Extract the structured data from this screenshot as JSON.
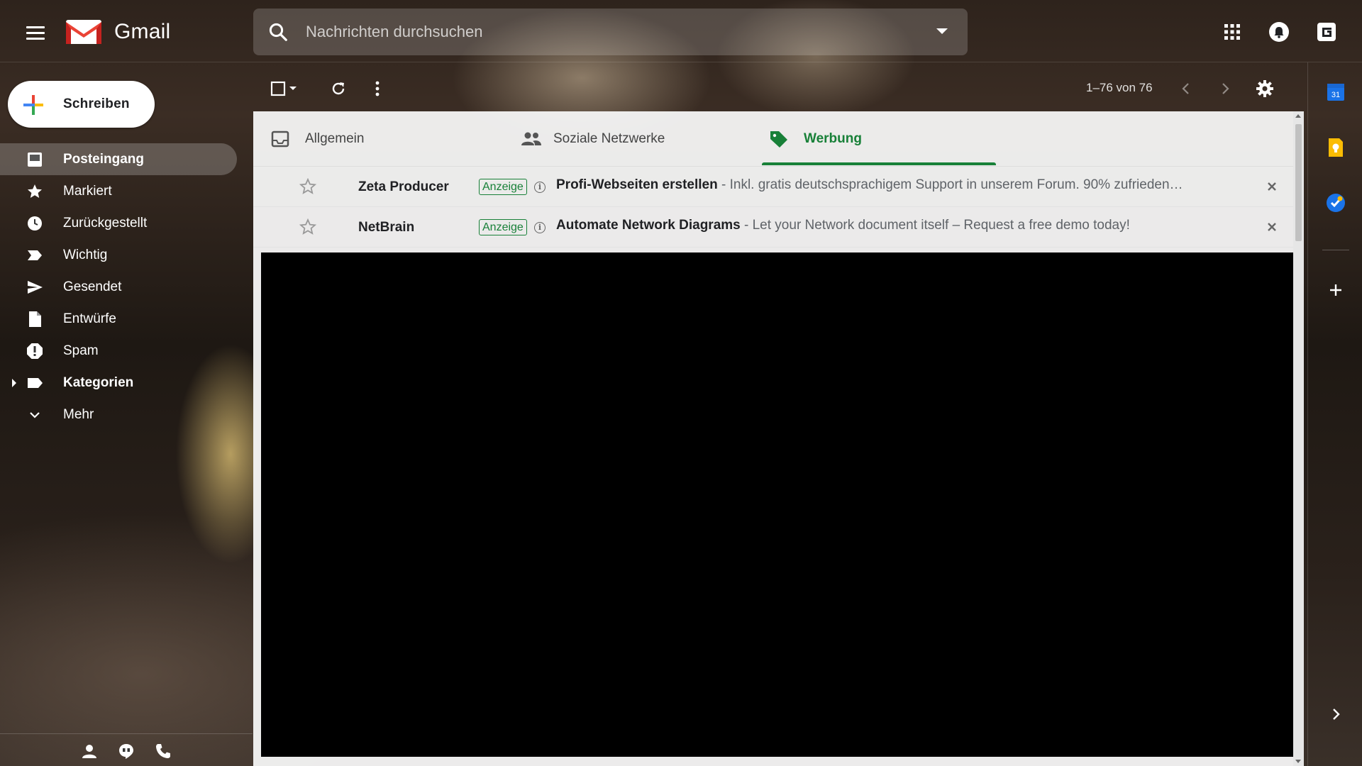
{
  "app": {
    "name": "Gmail"
  },
  "search": {
    "placeholder": "Nachrichten durchsuchen"
  },
  "compose": {
    "label": "Schreiben"
  },
  "nav": {
    "items": [
      {
        "label": "Posteingang",
        "icon": "inbox-icon",
        "active": true
      },
      {
        "label": "Markiert",
        "icon": "star-icon"
      },
      {
        "label": "Zurückgestellt",
        "icon": "clock-icon"
      },
      {
        "label": "Wichtig",
        "icon": "important-icon"
      },
      {
        "label": "Gesendet",
        "icon": "send-icon"
      },
      {
        "label": "Entwürfe",
        "icon": "draft-icon"
      },
      {
        "label": "Spam",
        "icon": "spam-icon"
      },
      {
        "label": "Kategorien",
        "icon": "label-icon"
      },
      {
        "label": "Mehr",
        "icon": "chevron-down-icon"
      }
    ]
  },
  "toolbar": {
    "pagination": "1–76 von 76"
  },
  "tabs": [
    {
      "label": "Allgemein",
      "icon": "inbox-icon"
    },
    {
      "label": "Soziale Netzwerke",
      "icon": "people-icon"
    },
    {
      "label": "Werbung",
      "icon": "tag-icon",
      "active": true
    }
  ],
  "emails": [
    {
      "sender": "Zeta Producer",
      "badge": "Anzeige",
      "subject": "Profi-Webseiten erstellen",
      "snippet": " - Inkl. gratis deutschsprachigem Support in unserem Forum. 90% zufrieden…"
    },
    {
      "sender": "NetBrain",
      "badge": "Anzeige",
      "subject": "Automate Network Diagrams",
      "snippet": " - Let your Network document itself – Request a free demo today!"
    }
  ],
  "side_panel": {
    "calendar_day": "31"
  },
  "colors": {
    "accent_green": "#188038",
    "gmail_red": "#EA4335",
    "calendar_blue": "#1a73e8",
    "keep_yellow": "#fbbc04"
  }
}
